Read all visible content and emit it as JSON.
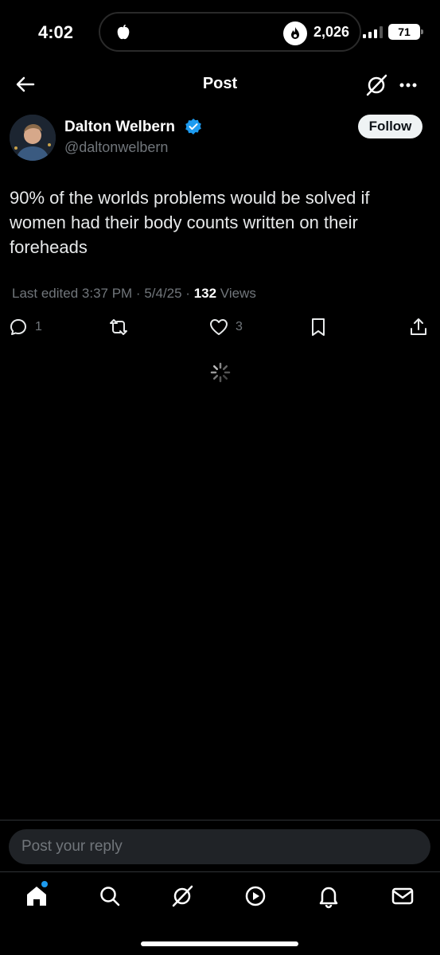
{
  "status_bar": {
    "time": "4:02",
    "streak_count": "2,026",
    "battery": "71"
  },
  "header": {
    "title": "Post"
  },
  "post": {
    "author_name": "Dalton Welbern",
    "handle": "@daltonwelbern",
    "follow_label": "Follow",
    "text": "90% of the worlds problems would be solved if women had their body counts written on their foreheads",
    "edited_label": "Last edited 3:37 PM · 5/4/25 · ",
    "views_count": "132",
    "views_label": " Views",
    "reply_count": "1",
    "like_count": "3"
  },
  "reply": {
    "placeholder": "Post your reply"
  },
  "nav": {
    "items": [
      "home-icon",
      "search-icon",
      "grok-icon",
      "video-icon",
      "notifications-icon",
      "messages-icon"
    ]
  },
  "colors": {
    "background": "#000000",
    "accent": "#1d9bf0",
    "muted": "#71767b",
    "text": "#e7e9ea"
  }
}
